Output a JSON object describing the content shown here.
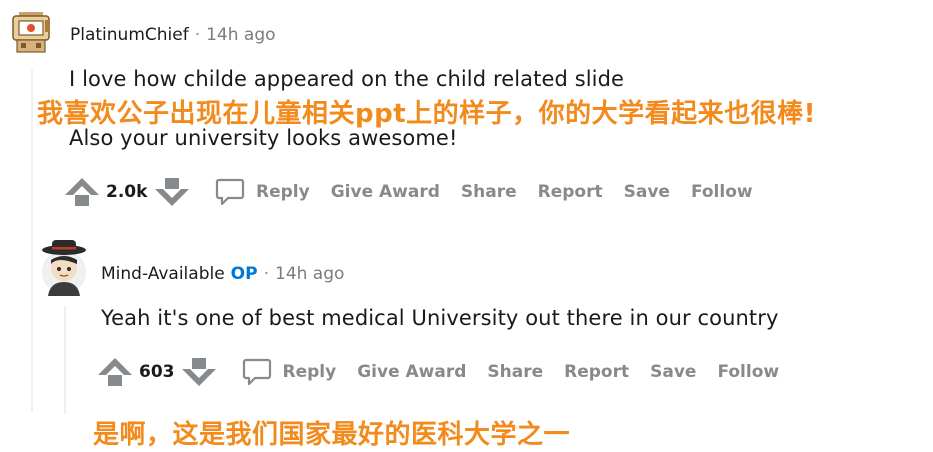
{
  "comment1": {
    "username": "PlatinumChief",
    "separator": "·",
    "time": "14h ago",
    "text_line1": "I love how childe appeared on the child related slide",
    "overlay_cn": "我喜欢公子出现在儿童相关ppt上的样子，你的大学看起来也很棒!",
    "text_line2": "Also your university looks awesome!",
    "votes": "2.0k"
  },
  "comment2": {
    "username": "Mind-Available",
    "op_badge": "OP",
    "separator": "·",
    "time": "14h ago",
    "text": "Yeah it's one of best medical University out there in our country",
    "votes": "603",
    "overlay_cn": "是啊，这是我们国家最好的医科大学之一"
  },
  "actions": {
    "reply": "Reply",
    "give_award": "Give Award",
    "share": "Share",
    "report": "Report",
    "save": "Save",
    "follow": "Follow"
  },
  "icons": {
    "upvote": "upvote-arrow-icon",
    "downvote": "downvote-arrow-icon",
    "reply": "speech-bubble-icon"
  },
  "colors": {
    "overlay_text": "#f28a1c",
    "op_badge": "#0079d3",
    "action_text": "#878a8c"
  }
}
